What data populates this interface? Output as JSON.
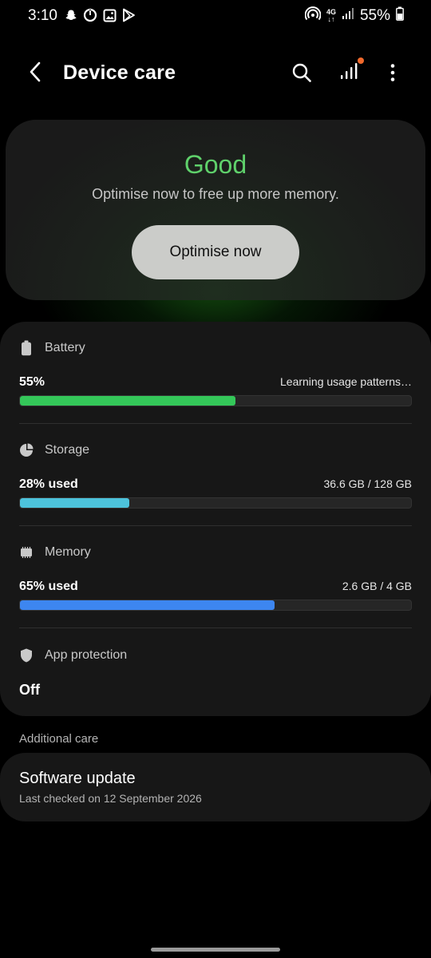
{
  "status_bar": {
    "time": "3:10",
    "network": "4G",
    "battery_percent": "55%"
  },
  "header": {
    "title": "Device care",
    "back_icon": "back-arrow-icon",
    "search_icon": "search-icon",
    "stats_icon": "signal-stats-icon",
    "more_icon": "more-vertical-icon"
  },
  "status_card": {
    "status": "Good",
    "subtitle": "Optimise now to free up more memory.",
    "button_label": "Optimise now",
    "status_color": "#5fd16b"
  },
  "metrics": {
    "battery": {
      "label": "Battery",
      "value": "55%",
      "detail": "Learning usage patterns…",
      "fill": 0.55,
      "color": "#34c759"
    },
    "storage": {
      "label": "Storage",
      "value": "28% used",
      "detail": "36.6 GB / 128 GB",
      "fill": 0.28,
      "color": "#4dc3dc"
    },
    "memory": {
      "label": "Memory",
      "value": "65% used",
      "detail": "2.6 GB / 4 GB",
      "fill": 0.65,
      "color": "#3d86f0"
    },
    "app_protection": {
      "label": "App protection",
      "value": "Off"
    }
  },
  "additional_care": {
    "section_label": "Additional care",
    "software_update": {
      "title": "Software update",
      "subtitle": "Last checked on 12 September 2026"
    }
  }
}
